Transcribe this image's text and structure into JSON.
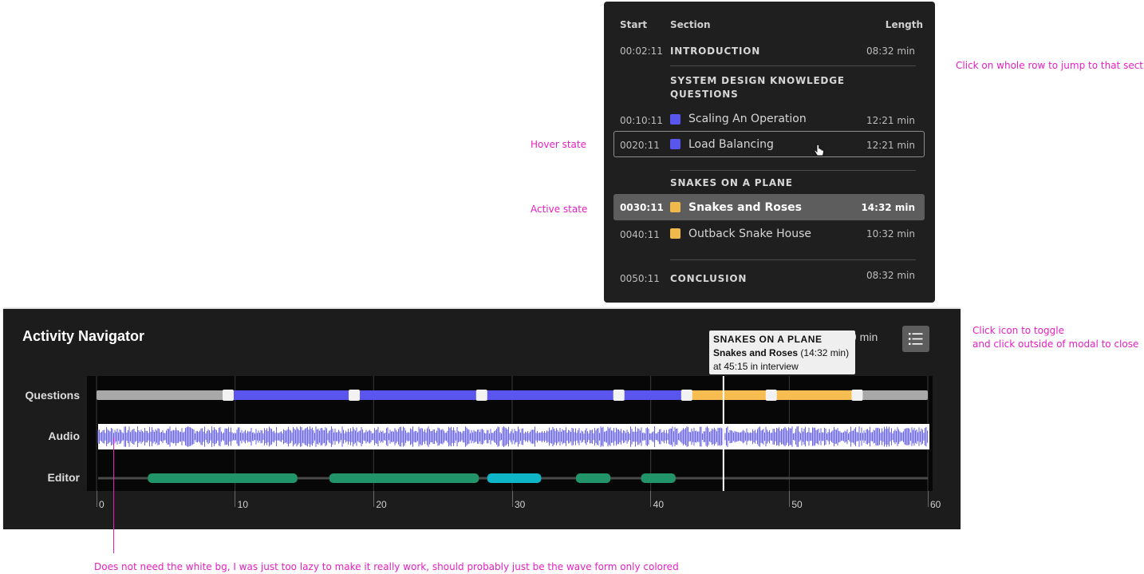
{
  "annotations": {
    "row_click": "Click on whole row to jump to that section",
    "hover": "Hover state",
    "active": "Active state",
    "toggle_line1": "Click icon to toggle",
    "toggle_line2": "and click outside of modal to close",
    "audio_note": "Does not need the white bg, I was just too lazy to make it really work, should probably just be the wave form only colored"
  },
  "sections_panel": {
    "headers": {
      "start": "Start",
      "section": "Section",
      "length": "Length"
    },
    "intro": {
      "start": "00:02:11",
      "label": "INTRODUCTION",
      "length": "08:32 min"
    },
    "group1": {
      "line1": "SYSTEM DESIGN KNOWLEDGE",
      "line2": "QUESTIONS"
    },
    "items": [
      {
        "start": "00:10:11",
        "name": "Scaling An Operation",
        "length": "12:21 min",
        "color": "#5b55f0",
        "state": "normal"
      },
      {
        "start": "0020:11",
        "name": "Load Balancing",
        "length": "12:21 min",
        "color": "#5b55f0",
        "state": "hover"
      },
      {
        "start": "0030:11",
        "name": "Snakes and Roses",
        "length": "14:32 min",
        "color": "#f0b94c",
        "state": "active"
      },
      {
        "start": "0040:11",
        "name": "Outback Snake House",
        "length": "10:32 min",
        "color": "#f0b94c",
        "state": "normal"
      }
    ],
    "group2": {
      "label": "SNAKES ON A PLANE"
    },
    "conclusion": {
      "start": "0050:11",
      "label": "CONCLUSION",
      "length": "08:32 min"
    }
  },
  "navigator": {
    "title": "Activity Navigator",
    "total_suffix": "9 min",
    "track_labels": {
      "questions": "Questions",
      "audio": "Audio",
      "editor": "Editor"
    },
    "tooltip": {
      "section": "SNAKES ON A PLANE",
      "name": "Snakes and Roses",
      "length": " (14:32 min)",
      "position": "at 45:15 in interview"
    },
    "ticks": [
      "0",
      "10",
      "20",
      "30",
      "40",
      "50",
      "60"
    ],
    "colors": {
      "question_blue": "#5b55f0",
      "question_yellow": "#f7bd50",
      "question_gray": "#a8a8a8",
      "editor_green": "#22946a",
      "editor_cyan": "#0db5c6",
      "audio_wave": "#6e69e3"
    }
  },
  "chart_data": {
    "type": "timeline",
    "x_range_min": [
      0,
      60
    ],
    "playhead_min": 45.25,
    "questions": [
      {
        "from": 0,
        "to": 9.5,
        "color": "gray"
      },
      {
        "from": 9.5,
        "to": 42.5,
        "color": "blue"
      },
      {
        "from": 42.5,
        "to": 54.7,
        "color": "yellow"
      },
      {
        "from": 54.7,
        "to": 60,
        "color": "gray"
      }
    ],
    "question_markers_min": [
      9.5,
      18.6,
      27.8,
      37.7,
      42.6,
      48.7,
      54.9
    ],
    "editor": [
      {
        "from": 3.7,
        "to": 14.5,
        "color": "green"
      },
      {
        "from": 16.8,
        "to": 27.6,
        "color": "green"
      },
      {
        "from": 28.2,
        "to": 32.1,
        "color": "cyan"
      },
      {
        "from": 34.6,
        "to": 37.1,
        "color": "green"
      },
      {
        "from": 39.3,
        "to": 41.8,
        "color": "green"
      }
    ]
  }
}
